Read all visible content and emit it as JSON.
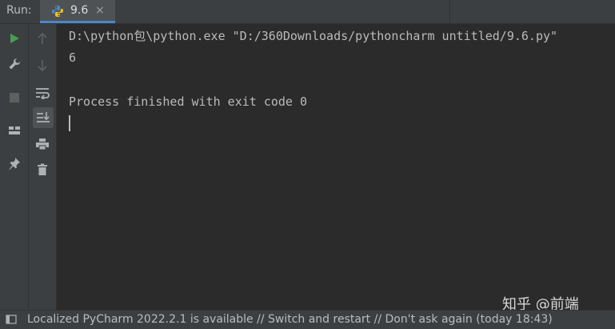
{
  "run_panel": {
    "label": "Run:",
    "tab": {
      "title": "9.6",
      "close_glyph": "×",
      "icon": "python-icon"
    }
  },
  "left_toolbar": {
    "items": [
      {
        "name": "rerun-icon",
        "color": "#499c54"
      },
      {
        "name": "wrench-icon",
        "color": "#afb1b3"
      },
      {
        "name": "stop-icon",
        "color": "#5e6060"
      },
      {
        "name": "layout-icon",
        "color": "#afb1b3"
      },
      {
        "name": "pin-icon",
        "color": "#afb1b3"
      }
    ]
  },
  "console_toolbar": {
    "items": [
      {
        "name": "up-arrow-icon"
      },
      {
        "name": "down-arrow-icon"
      },
      {
        "name": "soft-wrap-icon"
      },
      {
        "name": "scroll-to-end-icon",
        "active": true
      },
      {
        "name": "print-icon"
      },
      {
        "name": "trash-icon"
      }
    ]
  },
  "console": {
    "lines": [
      "D:\\python包\\python.exe \"D:/360Downloads/pythoncharm untitled/9.6.py\"",
      "6",
      "",
      "Process finished with exit code 0"
    ]
  },
  "watermark": "知乎 @前端",
  "status_bar": {
    "text": "Localized PyCharm 2022.2.1 is available // Switch and restart // Don't ask again (today 18:43)"
  },
  "colors": {
    "background": "#2b2b2b",
    "panel": "#3c3f41",
    "accent": "#4a88c7",
    "text": "#bbbbbb"
  }
}
